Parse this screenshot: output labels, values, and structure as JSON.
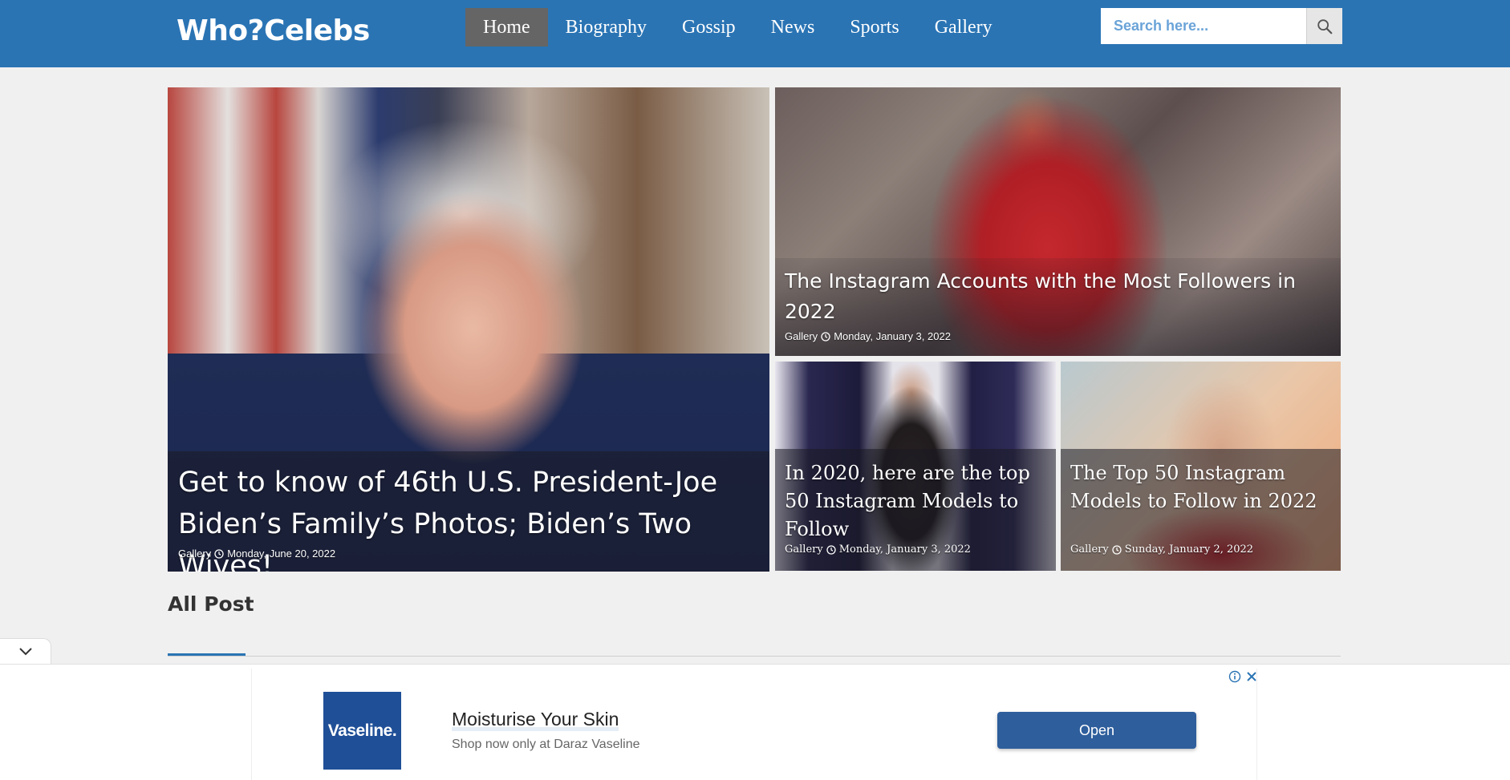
{
  "site": {
    "logo": "Who?Celebs"
  },
  "nav": {
    "items": [
      {
        "label": "Home",
        "active": true
      },
      {
        "label": "Biography"
      },
      {
        "label": "Gossip"
      },
      {
        "label": "News"
      },
      {
        "label": "Sports"
      },
      {
        "label": "Gallery"
      }
    ]
  },
  "search": {
    "placeholder": "Search here...",
    "icon": "search-icon"
  },
  "featured": [
    {
      "title": "Get to know of 46th U.S. President-Joe Biden’s Family’s Photos; Biden’s Two Wives!",
      "category": "Gallery",
      "date": "Monday, June 20, 2022"
    },
    {
      "title": "The Instagram Accounts with the Most Followers in 2022",
      "category": "Gallery",
      "date": "Monday, January 3, 2022"
    },
    {
      "title": "In 2020, here are the top 50 Instagram Models to Follow",
      "category": "Gallery",
      "date": "Monday, January 3, 2022"
    },
    {
      "title": "The Top 50 Instagram Models to Follow in 2022",
      "category": "Gallery",
      "date": "Sunday, January 2, 2022"
    }
  ],
  "section": {
    "title": "All Post"
  },
  "ad": {
    "brand": "Vaseline.",
    "headline": "Moisturise Your Skin",
    "subline": "Shop now only at Daraz Vaseline",
    "cta": "Open",
    "colors": {
      "brand": "#1f4f97",
      "button": "#2e5e9c"
    }
  },
  "colors": {
    "header": "#2a74b4",
    "active_nav": "#656565",
    "background": "#f0f0f0"
  }
}
